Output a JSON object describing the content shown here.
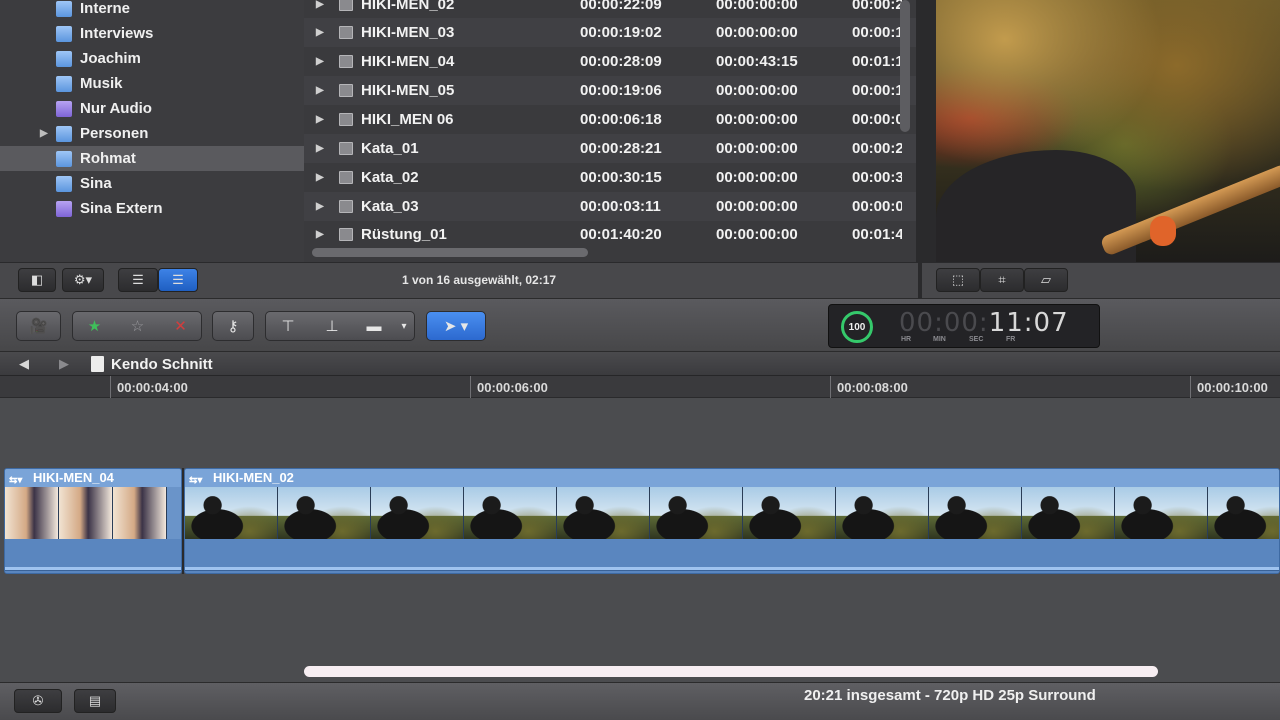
{
  "library": {
    "items": [
      {
        "label": "Interne",
        "color": "blue",
        "selected": false,
        "disclosure": false
      },
      {
        "label": "Interviews",
        "color": "blue",
        "selected": false,
        "disclosure": false
      },
      {
        "label": "Joachim",
        "color": "blue",
        "selected": false,
        "disclosure": false
      },
      {
        "label": "Musik",
        "color": "blue",
        "selected": false,
        "disclosure": false
      },
      {
        "label": "Nur Audio",
        "color": "purple",
        "selected": false,
        "disclosure": false
      },
      {
        "label": "Personen",
        "color": "blue",
        "selected": false,
        "disclosure": true
      },
      {
        "label": "Rohmat",
        "color": "blue",
        "selected": true,
        "disclosure": false
      },
      {
        "label": "Sina",
        "color": "blue",
        "selected": false,
        "disclosure": false
      },
      {
        "label": "Sina Extern",
        "color": "purple",
        "selected": false,
        "disclosure": false
      }
    ]
  },
  "browser": {
    "rows": [
      {
        "name": "HIKI-MEN_02",
        "duration": "00:00:22:09",
        "start": "00:00:00:00",
        "end": "00:00:2"
      },
      {
        "name": "HIKI-MEN_03",
        "duration": "00:00:19:02",
        "start": "00:00:00:00",
        "end": "00:00:1"
      },
      {
        "name": "HIKI-MEN_04",
        "duration": "00:00:28:09",
        "start": "00:00:43:15",
        "end": "00:01:1"
      },
      {
        "name": "HIKI-MEN_05",
        "duration": "00:00:19:06",
        "start": "00:00:00:00",
        "end": "00:00:1"
      },
      {
        "name": "HIKI_MEN 06",
        "duration": "00:00:06:18",
        "start": "00:00:00:00",
        "end": "00:00:0"
      },
      {
        "name": "Kata_01",
        "duration": "00:00:28:21",
        "start": "00:00:00:00",
        "end": "00:00:2"
      },
      {
        "name": "Kata_02",
        "duration": "00:00:30:15",
        "start": "00:00:00:00",
        "end": "00:00:3"
      },
      {
        "name": "Kata_03",
        "duration": "00:00:03:11",
        "start": "00:00:00:00",
        "end": "00:00:0"
      },
      {
        "name": "Rüstung_01",
        "duration": "00:01:40:20",
        "start": "00:00:00:00",
        "end": "00:01:4"
      }
    ],
    "selection_status": "1 von 16 ausgewählt, 02:17"
  },
  "dashboard": {
    "percent": "100",
    "timecode_dim": "00:00:",
    "timecode_lit": "11:07",
    "labels": {
      "hr": "HR",
      "min": "MIN",
      "sec": "SEC",
      "fr": "FR"
    }
  },
  "timeline": {
    "project_name": "Kendo Schnitt",
    "ruler": [
      "00:00:04:00",
      "00:00:06:00",
      "00:00:08:00",
      "00:00:10:00"
    ],
    "clips": [
      {
        "name": "HIKI-MEN_04"
      },
      {
        "name": "HIKI-MEN_02"
      }
    ]
  },
  "status_bar": {
    "text": "20:21 insgesamt - 720p HD 25p Surround"
  },
  "icons": {
    "library_toggle": "sidebar-icon",
    "action": "gear-icon",
    "list_view": "list-view-icon",
    "filmstrip_view": "filmstrip-view-icon",
    "import": "import-camera-icon",
    "favorite": "star-icon",
    "reject": "x-icon",
    "keyword": "key-icon",
    "connect": "connect-clip-icon",
    "insert": "insert-clip-icon",
    "append": "append-clip-icon",
    "select_tool": "arrow-pointer-icon",
    "transform": "transform-icon",
    "crop": "crop-icon",
    "distort": "distort-icon"
  },
  "colors": {
    "accent_blue": "#2c69cf",
    "clip_blue": "#6a94c9",
    "selection_gray": "#5a5a5e",
    "progress_green": "#35c96b"
  }
}
